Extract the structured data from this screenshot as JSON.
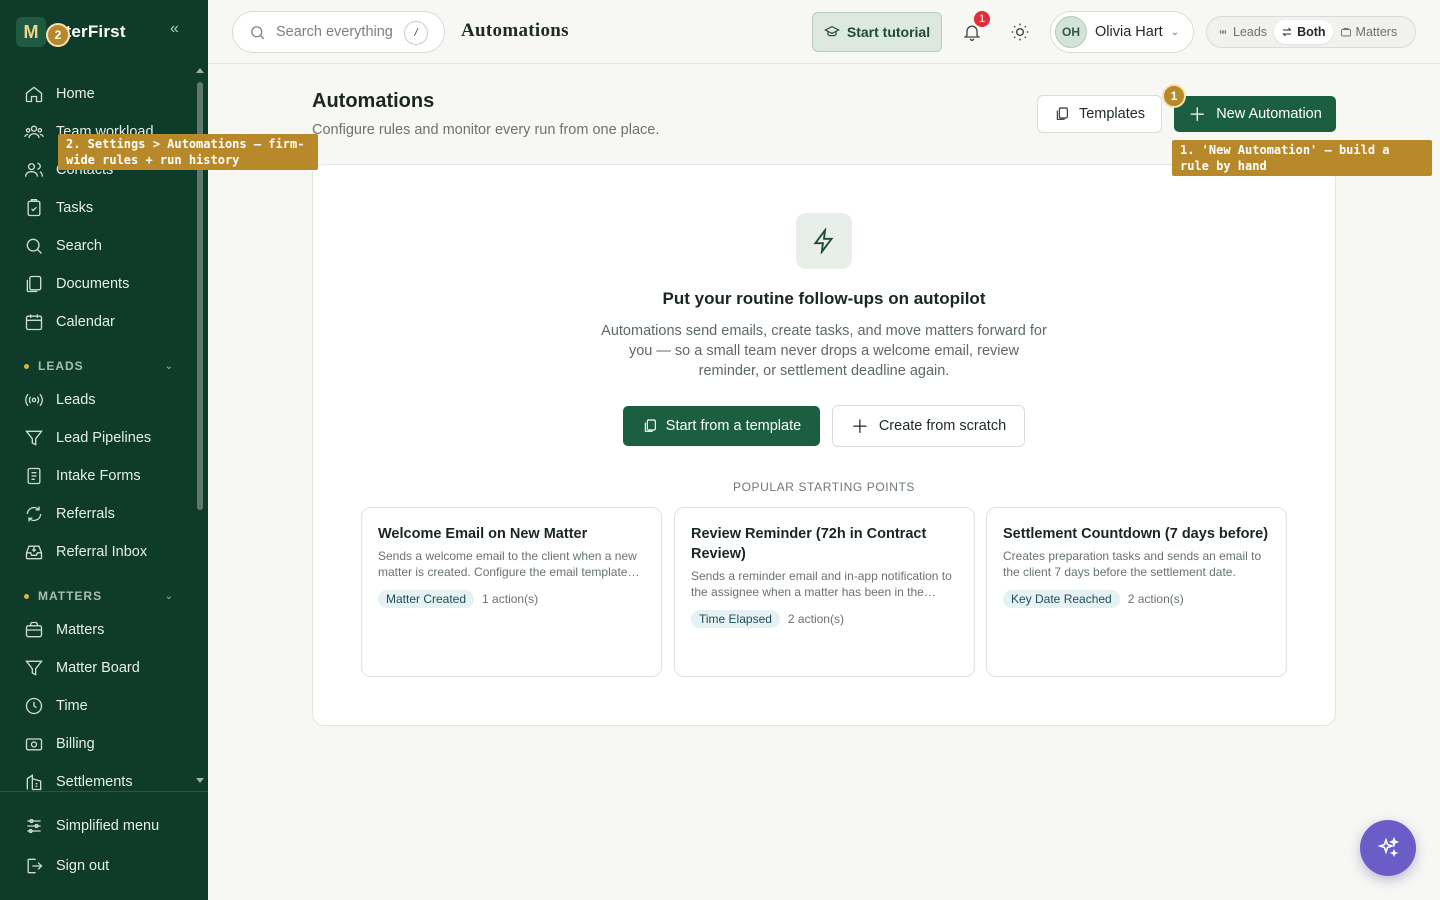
{
  "app": {
    "logo_letter": "M",
    "logo_text": "atterFirst"
  },
  "sidebar": {
    "items_top": [
      {
        "label": "Home",
        "icon": "home-icon"
      },
      {
        "label": "Team workload",
        "icon": "team-icon"
      },
      {
        "label": "Contacts",
        "icon": "contacts-icon"
      },
      {
        "label": "Tasks",
        "icon": "tasks-icon"
      },
      {
        "label": "Search",
        "icon": "search-icon"
      },
      {
        "label": "Documents",
        "icon": "documents-icon"
      },
      {
        "label": "Calendar",
        "icon": "calendar-icon"
      }
    ],
    "leads_section": "LEADS",
    "items_leads": [
      {
        "label": "Leads",
        "icon": "broadcast-icon"
      },
      {
        "label": "Lead Pipelines",
        "icon": "filter-icon"
      },
      {
        "label": "Intake Forms",
        "icon": "form-icon"
      },
      {
        "label": "Referrals",
        "icon": "refresh-icon"
      },
      {
        "label": "Referral Inbox",
        "icon": "inbox-icon"
      }
    ],
    "matters_section": "MATTERS",
    "items_matters": [
      {
        "label": "Matters",
        "icon": "briefcase-icon"
      },
      {
        "label": "Matter Board",
        "icon": "board-icon"
      },
      {
        "label": "Time",
        "icon": "clock-icon"
      },
      {
        "label": "Billing",
        "icon": "billing-icon"
      },
      {
        "label": "Settlements",
        "icon": "building-icon"
      }
    ],
    "bottom": [
      {
        "label": "Simplified menu",
        "icon": "sliders-icon"
      },
      {
        "label": "Sign out",
        "icon": "sign-out-icon"
      }
    ]
  },
  "topbar": {
    "search_placeholder": "Search everything",
    "search_shortcut": "/",
    "page_heading": "Automations",
    "tutorial_label": "Start tutorial",
    "notifications_count": "1",
    "user_initials": "OH",
    "user_name": "Olivia Hart",
    "modes": [
      "Leads",
      "Both",
      "Matters"
    ],
    "active_mode": "Both"
  },
  "main": {
    "title": "Automations",
    "subtitle": "Configure rules and monitor every run from one place.",
    "templates_label": "Templates",
    "new_label": "New Automation",
    "empty_title": "Put your routine follow-ups on autopilot",
    "empty_desc": "Automations send emails, create tasks, and move matters forward for you — so a small team never drops a welcome email, review reminder, or settlement deadline again.",
    "start_template_label": "Start from a template",
    "scratch_label": "Create from scratch",
    "popular_label": "POPULAR STARTING POINTS",
    "templates": [
      {
        "title": "Welcome Email on New Matter",
        "desc": "Sends a welcome email to the client when a new matter is created. Configure the email template…",
        "trigger": "Matter Created",
        "actions": "1 action(s)"
      },
      {
        "title": "Review Reminder (72h in Contract Review)",
        "desc": "Sends a reminder email and in-app notification to the assignee when a matter has been in the…",
        "trigger": "Time Elapsed",
        "actions": "2 action(s)"
      },
      {
        "title": "Settlement Countdown (7 days before)",
        "desc": "Creates preparation tasks and sends an email to the client 7 days before the settlement date.",
        "trigger": "Key Date Reached",
        "actions": "2 action(s)"
      }
    ]
  },
  "tutorial": {
    "step1_num": "1",
    "step1_text": "1. 'New Automation' — build a rule by hand",
    "step2_num": "2",
    "step2_text": "2. Settings > Automations — firm-wide rules + run history"
  },
  "colors": {
    "sidebar_bg": "#0e3b2a",
    "primary": "#1b5e40",
    "callout": "#b8892b",
    "ai_button": "#6b5cc8",
    "badge_red": "#e12d39"
  }
}
